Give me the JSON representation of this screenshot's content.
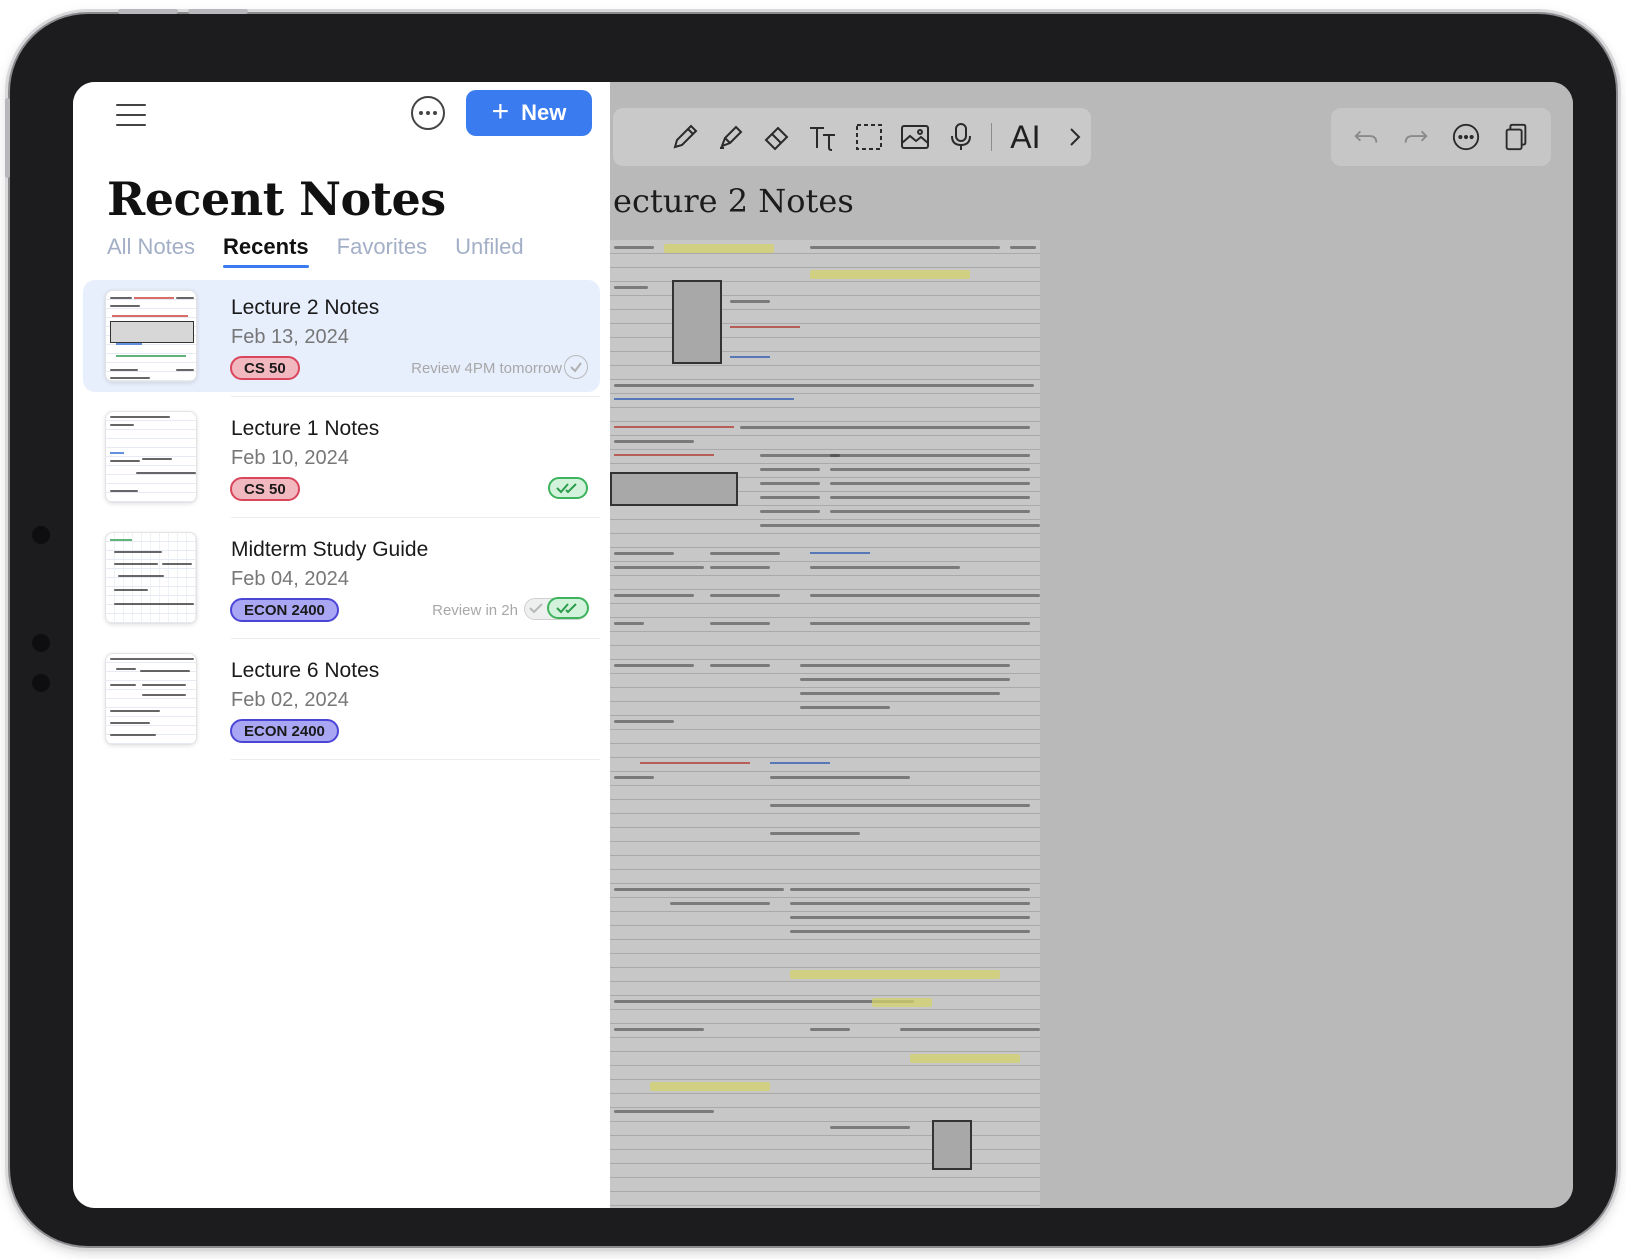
{
  "panel": {
    "title": "Recent Notes",
    "new_button": {
      "icon": "+",
      "label": "New"
    },
    "tabs": [
      "All Notes",
      "Recents",
      "Favorites",
      "Unfiled"
    ],
    "active_tab": "Recents"
  },
  "notes": [
    {
      "title": "Lecture 2 Notes",
      "date": "Feb 13, 2024",
      "tag": "CS 50",
      "tag_color": "#f2b8bf",
      "review": "Review 4PM tomorrow",
      "status": "check-circle"
    },
    {
      "title": "Lecture 1 Notes",
      "date": "Feb 10, 2024",
      "tag": "CS 50",
      "tag_color": "#f2b8bf",
      "review": "",
      "status": "double-check"
    },
    {
      "title": "Midterm Study Guide",
      "date": "Feb 04, 2024",
      "tag": "ECON 2400",
      "tag_color": "#a9a7f3",
      "review": "Review in 2h",
      "status": "toggle-double-check"
    },
    {
      "title": "Lecture 6 Notes",
      "date": "Feb 02, 2024",
      "tag": "ECON 2400",
      "tag_color": "#a9a7f3",
      "review": "",
      "status": "none"
    }
  ],
  "editor": {
    "doc_title": "ecture 2 Notes",
    "ai_label": "AI",
    "tools": [
      "pen-icon",
      "highlighter-icon",
      "eraser-icon",
      "text-icon",
      "lasso-select-icon",
      "image-icon",
      "microphone-icon",
      "ai-icon",
      "chevron-right-icon"
    ],
    "right_tools": [
      "undo-icon",
      "redo-icon",
      "more-icon",
      "pages-icon"
    ]
  },
  "colors": {
    "accent": "#3a7cf0",
    "cs50_badge": "#d9455b",
    "econ_badge": "#4b45d6",
    "done_green": "#3cb35c"
  }
}
